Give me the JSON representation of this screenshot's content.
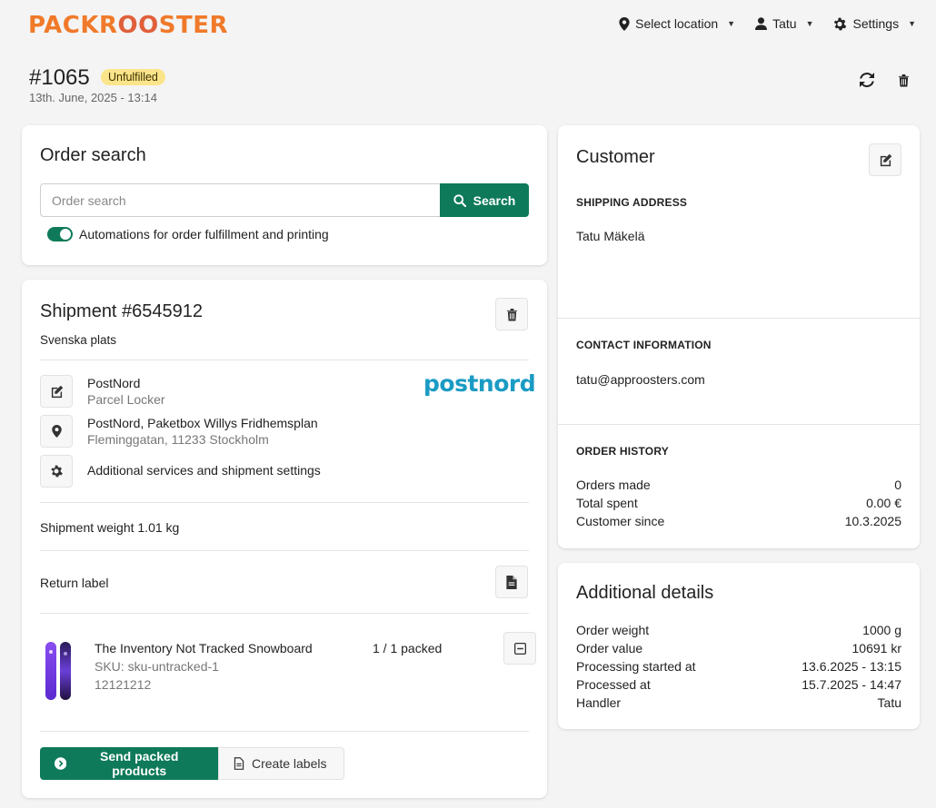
{
  "brand": {
    "logo_text_a": "PACKR",
    "logo_text_b": "OO",
    "logo_text_c": "STER",
    "color": "#f07a2a"
  },
  "nav": {
    "location": "Select location",
    "user": "Tatu",
    "settings": "Settings"
  },
  "order": {
    "number": "#1065",
    "status": "Unfulfilled",
    "date": "13th. June, 2025 - 13:14"
  },
  "search": {
    "title": "Order search",
    "placeholder": "Order search",
    "button": "Search",
    "automation_label": "Automations for order fulfillment and printing"
  },
  "shipment": {
    "title": "Shipment #6545912",
    "subtitle": "Svenska plats",
    "carrier": "PostNord",
    "service": "Parcel Locker",
    "carrier_logo": "postnord",
    "pickup_name": "PostNord, Paketbox Willys Fridhemsplan",
    "pickup_address": "Fleminggatan, 11233 Stockholm",
    "additional": "Additional services and shipment settings",
    "weight": "Shipment weight 1.01 kg",
    "return_label": "Return label",
    "product": {
      "name": "The Inventory Not Tracked Snowboard",
      "sku": "SKU: sku-untracked-1",
      "barcode": "12121212",
      "packed": "1 / 1 packed"
    },
    "send_button": "Send packed products",
    "labels_button": "Create labels"
  },
  "customer": {
    "title": "Customer",
    "shipping_label": "SHIPPING ADDRESS",
    "name": "Tatu Mäkelä",
    "contact_label": "CONTACT INFORMATION",
    "email": "tatu@approosters.com",
    "history_label": "ORDER HISTORY",
    "history": [
      {
        "k": "Orders made",
        "v": "0"
      },
      {
        "k": "Total spent",
        "v": "0.00 €"
      },
      {
        "k": "Customer since",
        "v": "10.3.2025"
      }
    ]
  },
  "details": {
    "title": "Additional details",
    "rows": [
      {
        "k": "Order weight",
        "v": "1000 g"
      },
      {
        "k": "Order value",
        "v": "10691 kr"
      },
      {
        "k": "Processing started at",
        "v": "13.6.2025 - 13:15"
      },
      {
        "k": "Processed at",
        "v": "15.7.2025 - 14:47"
      },
      {
        "k": "Handler",
        "v": "Tatu"
      }
    ]
  },
  "colors": {
    "primary": "#0e7a5a",
    "badge": "#fbe58a",
    "postnord": "#1a9bc4"
  }
}
